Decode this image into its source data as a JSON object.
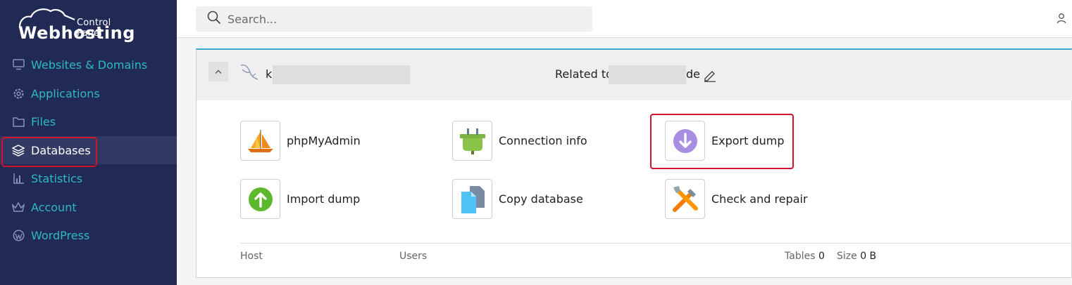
{
  "brand": {
    "line1": "Control Panel",
    "line2": "Webhosting"
  },
  "sidebar": {
    "items": [
      {
        "label": "Websites & Domains",
        "icon": "monitor-icon"
      },
      {
        "label": "Applications",
        "icon": "gear-icon"
      },
      {
        "label": "Files",
        "icon": "folder-icon"
      },
      {
        "label": "Databases",
        "icon": "layers-icon",
        "active": true
      },
      {
        "label": "Statistics",
        "icon": "bar-chart-icon"
      },
      {
        "label": "Account",
        "icon": "account-icon"
      },
      {
        "label": "WordPress",
        "icon": "wordpress-icon"
      }
    ]
  },
  "search": {
    "placeholder": "Search..."
  },
  "database": {
    "name_prefix": "k",
    "related_label": "Related to",
    "related_suffix": "de"
  },
  "tools": [
    {
      "label": "phpMyAdmin",
      "icon": "phpmyadmin-icon"
    },
    {
      "label": "Connection info",
      "icon": "plug-icon"
    },
    {
      "label": "Export dump",
      "icon": "export-download-icon",
      "highlighted": true
    },
    {
      "label": "Import dump",
      "icon": "import-upload-icon"
    },
    {
      "label": "Copy database",
      "icon": "copy-icon"
    },
    {
      "label": "Check and repair",
      "icon": "repair-tools-icon"
    }
  ],
  "footer": {
    "host_label": "Host",
    "users_label": "Users",
    "tables_label": "Tables",
    "tables_value": "0",
    "size_label": "Size",
    "size_value": "0 B"
  },
  "colors": {
    "sidebar_bg": "#212a55",
    "nav_text": "#2fb9c2",
    "highlight": "#d0142a",
    "accent_border": "#3aa8d0"
  }
}
